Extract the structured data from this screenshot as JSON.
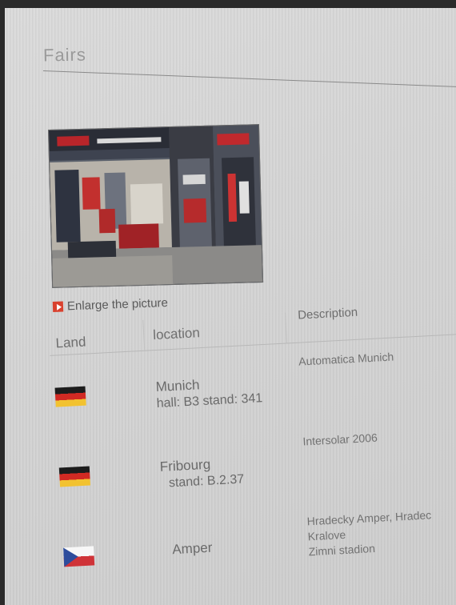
{
  "page": {
    "title": "Fairs"
  },
  "photo": {
    "enlarge_label": "Enlarge the picture"
  },
  "table": {
    "headers": {
      "land": "Land",
      "location": "location",
      "description": "Description"
    },
    "rows": [
      {
        "flag": "germany-flag-icon",
        "city": "Munich",
        "detail": "hall: B3  stand: 341",
        "description": [
          "Automatica Munich"
        ]
      },
      {
        "flag": "germany-flag-icon",
        "city": "Fribourg",
        "detail": "stand: B.2.37",
        "description": [
          "Intersolar 2006"
        ]
      },
      {
        "flag": "czech-flag-icon",
        "city": "Amper",
        "detail": "",
        "description": [
          "Hradecky Amper, Hradec",
          "Kralove",
          "Zimni stadion"
        ]
      }
    ]
  },
  "colors": {
    "accent": "#d9412e",
    "text": "#6a6a6a",
    "background": "#d8d8d8"
  }
}
